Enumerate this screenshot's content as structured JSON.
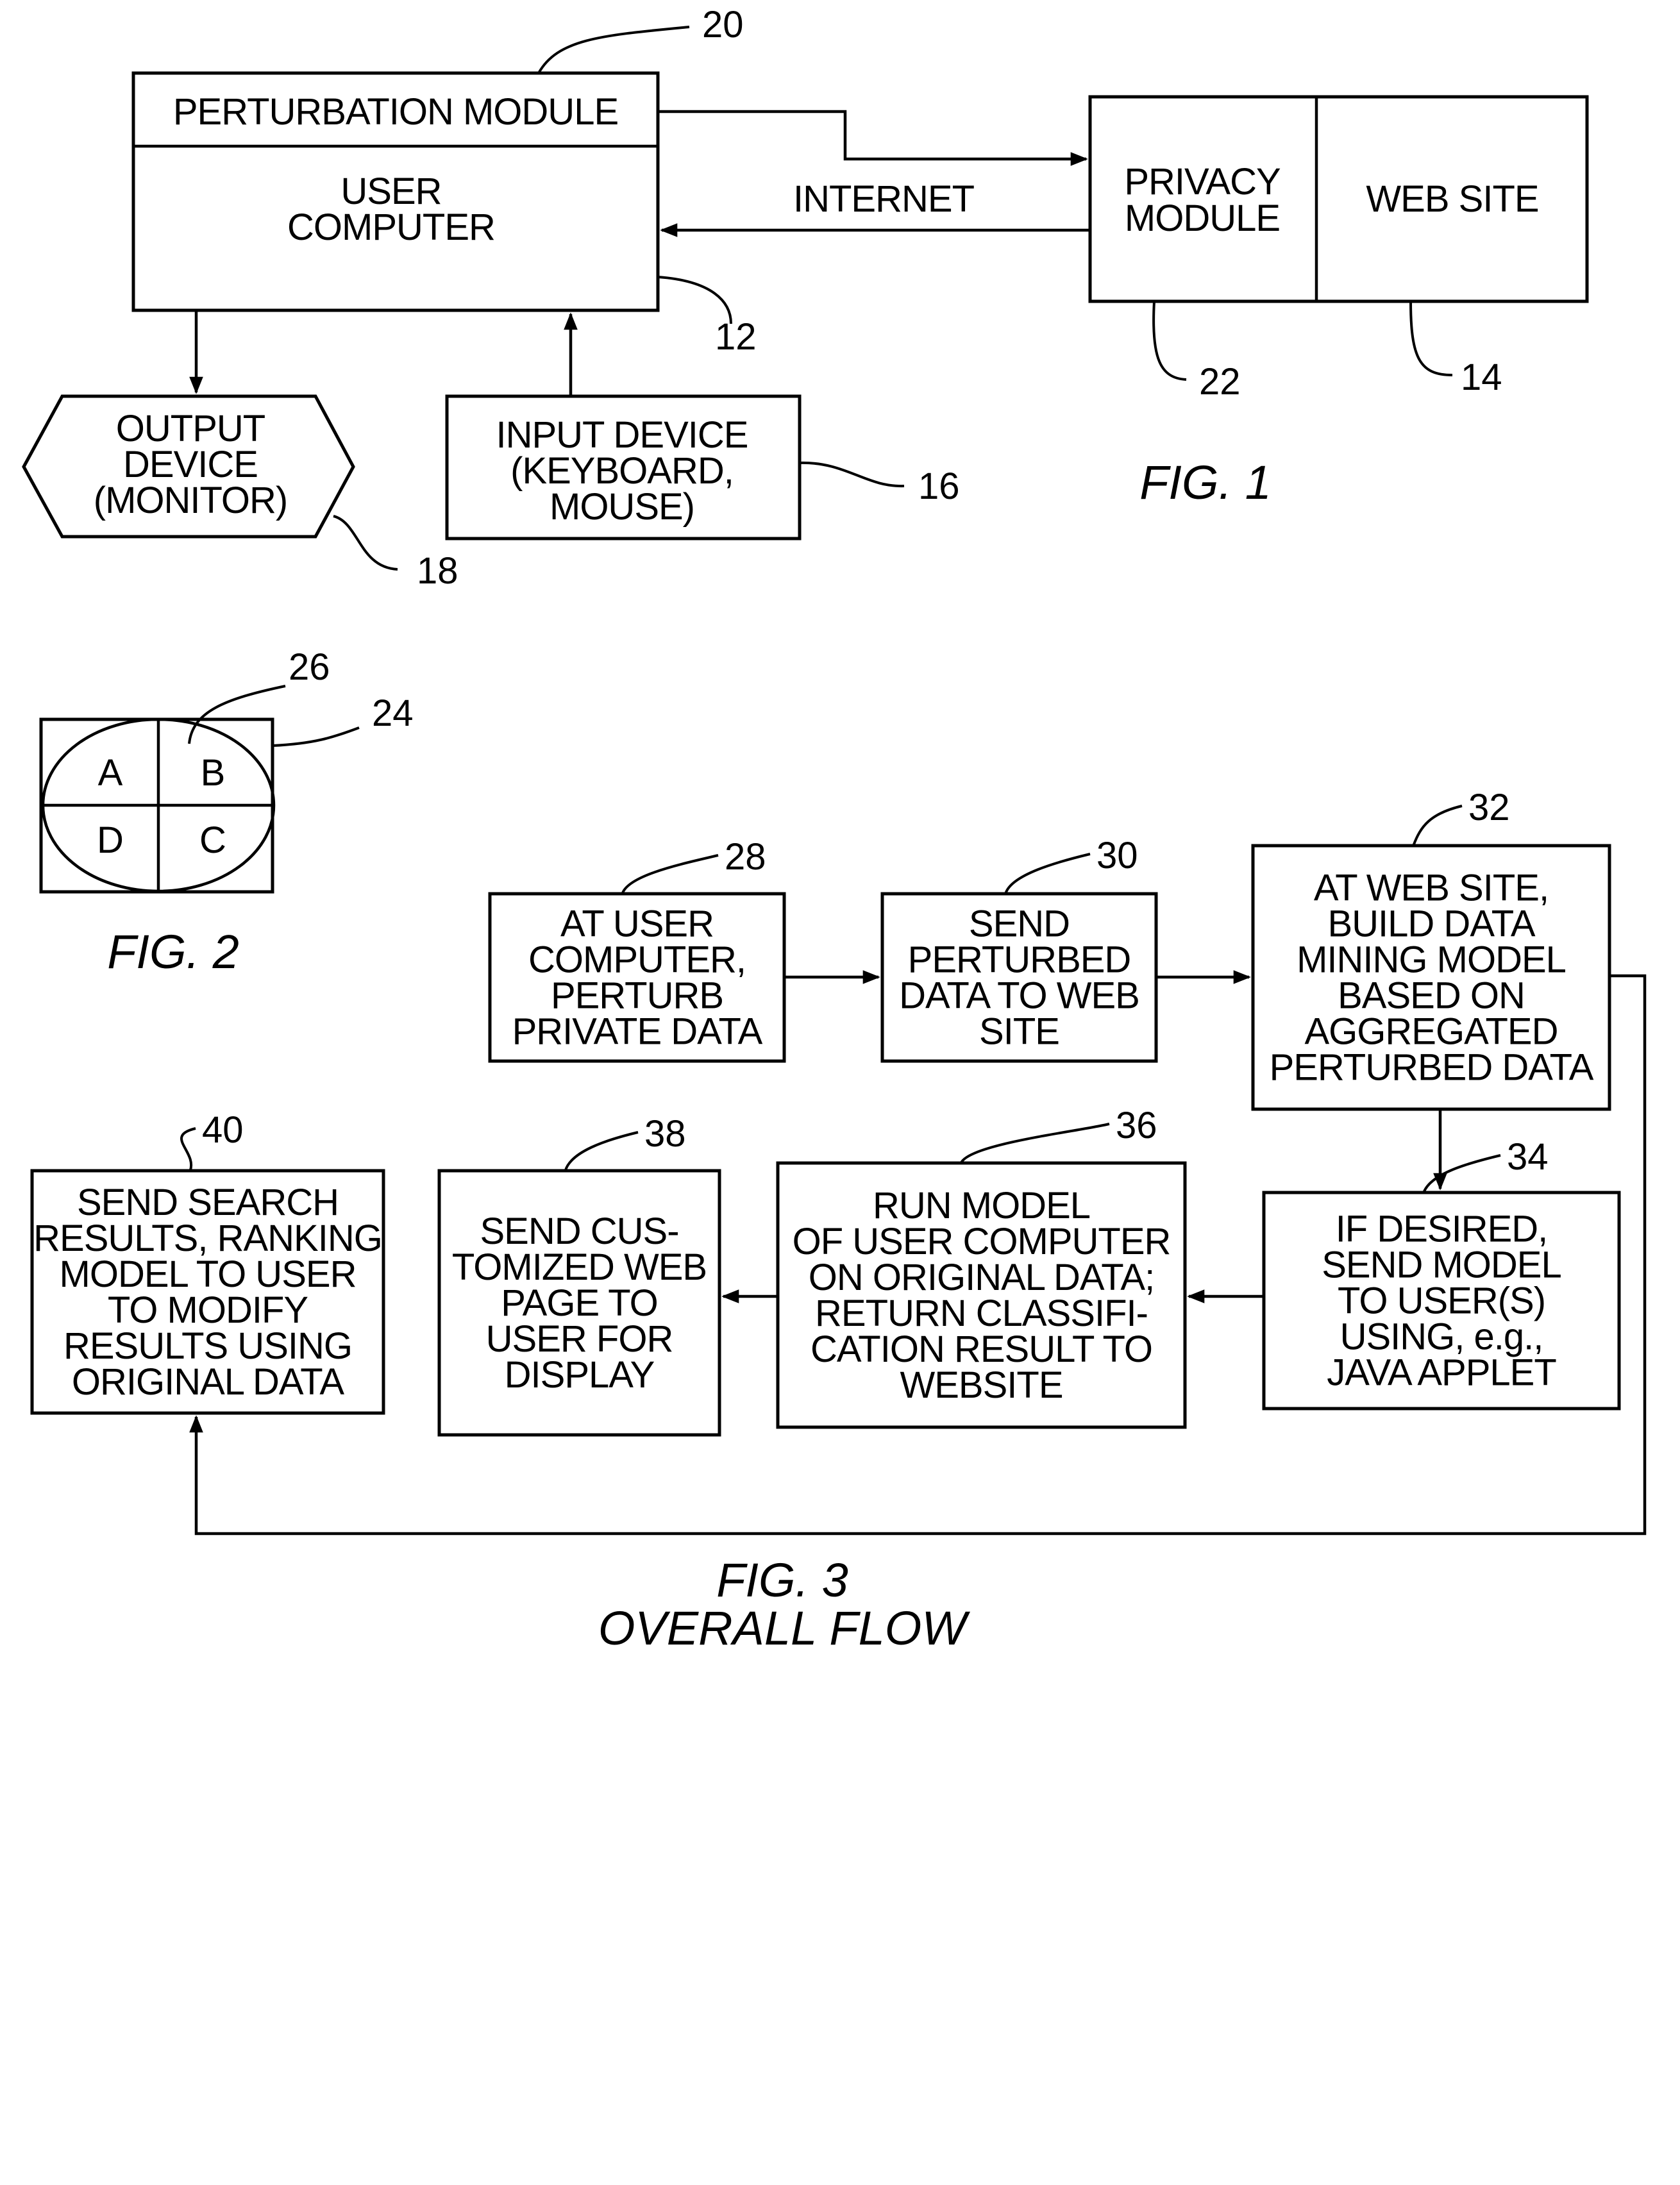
{
  "fig1": {
    "caption": "FIG. 1",
    "user_computer": {
      "module_label": "PERTURBATION MODULE",
      "lines": [
        "USER",
        "COMPUTER"
      ],
      "ref": "12",
      "module_ref": "20"
    },
    "server": {
      "privacy_lines": [
        "PRIVACY",
        "MODULE"
      ],
      "website_label": "WEB SITE",
      "privacy_ref": "22",
      "website_ref": "14"
    },
    "internet_label": "INTERNET",
    "output_device": {
      "lines": [
        "OUTPUT",
        "DEVICE",
        "(MONITOR)"
      ],
      "ref": "18"
    },
    "input_device": {
      "lines": [
        "INPUT DEVICE",
        "(KEYBOARD,",
        "MOUSE)"
      ],
      "ref": "16"
    }
  },
  "fig2": {
    "caption": "FIG. 2",
    "quadrants": [
      "A",
      "B",
      "C",
      "D"
    ],
    "box_ref": "24",
    "circle_ref": "26"
  },
  "fig3": {
    "caption_lines": [
      "FIG. 3",
      "OVERALL FLOW"
    ],
    "steps": [
      {
        "ref": "28",
        "lines": [
          "AT USER",
          "COMPUTER,",
          "PERTURB",
          "PRIVATE DATA"
        ]
      },
      {
        "ref": "30",
        "lines": [
          "SEND",
          "PERTURBED",
          "DATA TO WEB",
          "SITE"
        ]
      },
      {
        "ref": "32",
        "lines": [
          "AT WEB SITE,",
          "BUILD DATA",
          "MINING MODEL",
          "BASED ON",
          "AGGREGATED",
          "PERTURBED DATA"
        ]
      },
      {
        "ref": "34",
        "lines": [
          "IF DESIRED,",
          "SEND MODEL",
          "TO USER(S)",
          "USING, e.g.,",
          "JAVA APPLET"
        ]
      },
      {
        "ref": "36",
        "lines": [
          "RUN MODEL",
          "OF USER COMPUTER",
          "ON ORIGINAL DATA;",
          "RETURN CLASSIFI-",
          "CATION RESULT TO",
          "WEBSITE"
        ]
      },
      {
        "ref": "38",
        "lines": [
          "SEND CUS-",
          "TOMIZED WEB",
          "PAGE TO",
          "USER FOR",
          "DISPLAY"
        ]
      },
      {
        "ref": "40",
        "lines": [
          "SEND SEARCH",
          "RESULTS, RANKING",
          "MODEL TO USER",
          "TO MODIFY",
          "RESULTS USING",
          "ORIGINAL DATA"
        ]
      }
    ]
  }
}
